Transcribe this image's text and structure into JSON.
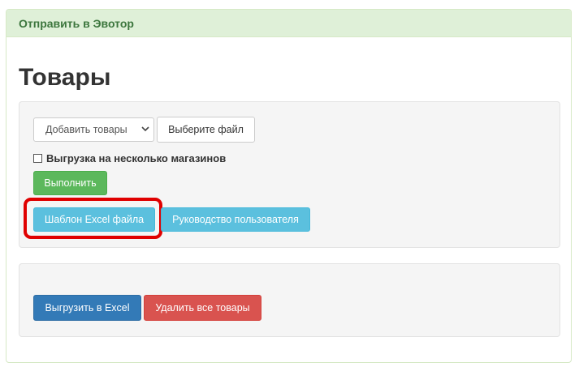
{
  "panel": {
    "heading": "Отправить в Эвотор"
  },
  "page": {
    "title": "Товары"
  },
  "import_section": {
    "action_select": {
      "selected": "Добавить товары"
    },
    "file_button": "Выберите файл",
    "multi_store_checkbox": {
      "label": "Выгрузка на несколько магазинов",
      "checked": false
    },
    "run_button": "Выполнить",
    "template_button": "Шаблон Excel файла",
    "guide_button": "Руководство пользователя"
  },
  "export_section": {
    "export_button": "Выгрузить в Excel",
    "delete_all_button": "Удалить все товары"
  },
  "colors": {
    "heading_bg": "#dff0d8",
    "success": "#5cb85c",
    "info": "#5bc0de",
    "primary": "#337ab7",
    "danger": "#d9534f",
    "highlight": "#e00000"
  },
  "icons": {
    "select_arrow": "chevron-down-icon"
  }
}
